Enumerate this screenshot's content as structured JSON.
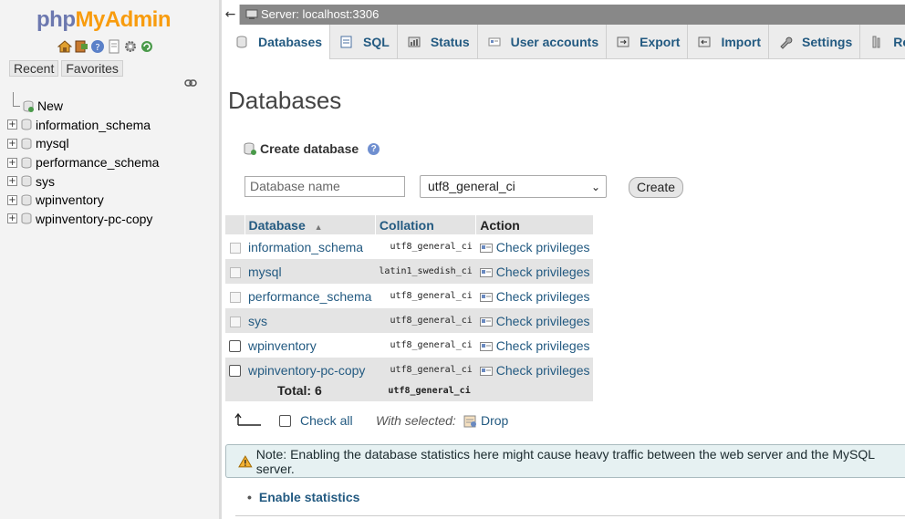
{
  "navigation": {
    "logo": {
      "php": "php",
      "my": "My",
      "admin": "Admin"
    },
    "icons": [
      "home-icon",
      "logout-icon",
      "help-icon",
      "docs-icon",
      "settings-icon",
      "reload-icon"
    ],
    "tabs": [
      "Recent",
      "Favorites"
    ],
    "tree": [
      {
        "label": "New",
        "new": true
      },
      {
        "label": "information_schema"
      },
      {
        "label": "mysql"
      },
      {
        "label": "performance_schema"
      },
      {
        "label": "sys"
      },
      {
        "label": "wpinventory"
      },
      {
        "label": "wpinventory-pc-copy"
      }
    ]
  },
  "topbar": {
    "back": "←",
    "server": "Server: localhost:3306"
  },
  "tabs": [
    {
      "label": "Databases",
      "icon": "database-icon",
      "active": true
    },
    {
      "label": "SQL",
      "icon": "sql-icon"
    },
    {
      "label": "Status",
      "icon": "status-icon"
    },
    {
      "label": "User accounts",
      "icon": "users-icon"
    },
    {
      "label": "Export",
      "icon": "export-icon"
    },
    {
      "label": "Import",
      "icon": "import-icon"
    },
    {
      "label": "Settings",
      "icon": "wrench-icon"
    },
    {
      "label": "Rep",
      "icon": "replication-icon"
    }
  ],
  "main": {
    "title": "Databases",
    "create": {
      "heading": "Create database",
      "placeholder": "Database name",
      "collation": "utf8_general_ci",
      "button": "Create"
    },
    "table": {
      "headers": {
        "database": "Database",
        "sort": "▲",
        "collation": "Collation",
        "action": "Action"
      },
      "rows": [
        {
          "name": "information_schema",
          "collation": "utf8_general_ci",
          "action": "Check privileges",
          "system": true
        },
        {
          "name": "mysql",
          "collation": "latin1_swedish_ci",
          "action": "Check privileges",
          "system": true
        },
        {
          "name": "performance_schema",
          "collation": "utf8_general_ci",
          "action": "Check privileges",
          "system": true
        },
        {
          "name": "sys",
          "collation": "utf8_general_ci",
          "action": "Check privileges",
          "system": true
        },
        {
          "name": "wpinventory",
          "collation": "utf8_general_ci",
          "action": "Check privileges",
          "system": false
        },
        {
          "name": "wpinventory-pc-copy",
          "collation": "utf8_general_ci",
          "action": "Check privileges",
          "system": false
        }
      ],
      "total_label": "Total: 6",
      "total_collation": "utf8_general_ci"
    },
    "check_all": "Check all",
    "with_selected": "With selected:",
    "drop": "Drop",
    "notice": "Note: Enabling the database statistics here might cause heavy traffic between the web server and the MySQL server.",
    "enable_statistics": "Enable statistics"
  },
  "colors": {
    "link": "#235a81",
    "logo_php": "#6c78af",
    "logo_myadmin": "#f89c0e",
    "notice_bg": "#e6f1f2"
  }
}
